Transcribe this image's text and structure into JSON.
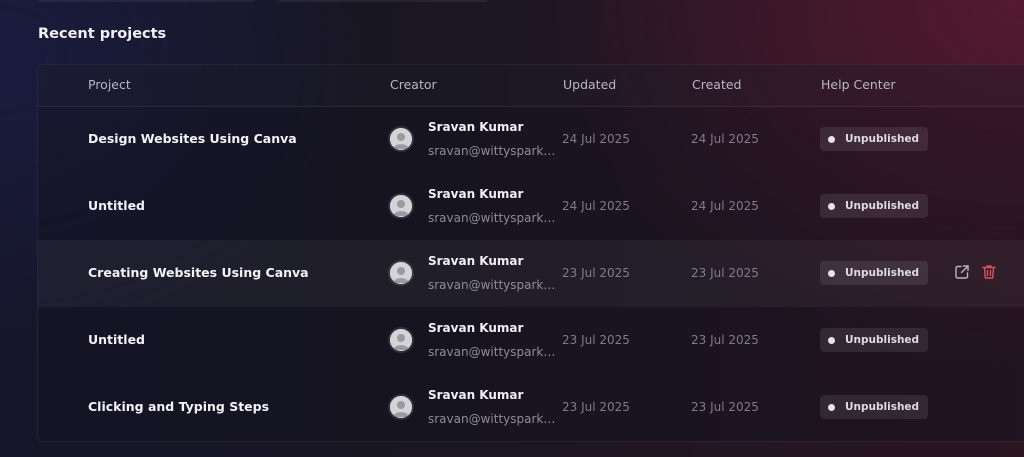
{
  "section_title": "Recent projects",
  "table": {
    "columns": {
      "project": "Project",
      "creator": "Creator",
      "updated": "Updated",
      "created": "Created",
      "help_center": "Help Center"
    },
    "rows": [
      {
        "project": "Design Websites Using Canva",
        "creator_name": "Sravan Kumar",
        "creator_email": "sravan@wittysparks.com",
        "updated": "24 Jul 2025",
        "created": "24 Jul 2025",
        "status": "Unpublished"
      },
      {
        "project": "Untitled",
        "creator_name": "Sravan Kumar",
        "creator_email": "sravan@wittysparks.com",
        "updated": "24 Jul 2025",
        "created": "24 Jul 2025",
        "status": "Unpublished"
      },
      {
        "project": "Creating Websites Using Canva",
        "creator_name": "Sravan Kumar",
        "creator_email": "sravan@wittysparks.com",
        "updated": "23 Jul 2025",
        "created": "23 Jul 2025",
        "status": "Unpublished"
      },
      {
        "project": "Untitled",
        "creator_name": "Sravan Kumar",
        "creator_email": "sravan@wittysparks.com",
        "updated": "23 Jul 2025",
        "created": "23 Jul 2025",
        "status": "Unpublished"
      },
      {
        "project": "Clicking and Typing Steps",
        "creator_name": "Sravan Kumar",
        "creator_email": "sravan@wittysparks.com",
        "updated": "23 Jul 2025",
        "created": "23 Jul 2025",
        "status": "Unpublished"
      }
    ],
    "hovered_row": 2,
    "row_actions": [
      "open-external-icon",
      "trash-icon"
    ]
  },
  "colors": {
    "delete_icon": "#e0525c",
    "open_icon": "#b8b4c2",
    "status_dot": "#e7e3ec"
  }
}
